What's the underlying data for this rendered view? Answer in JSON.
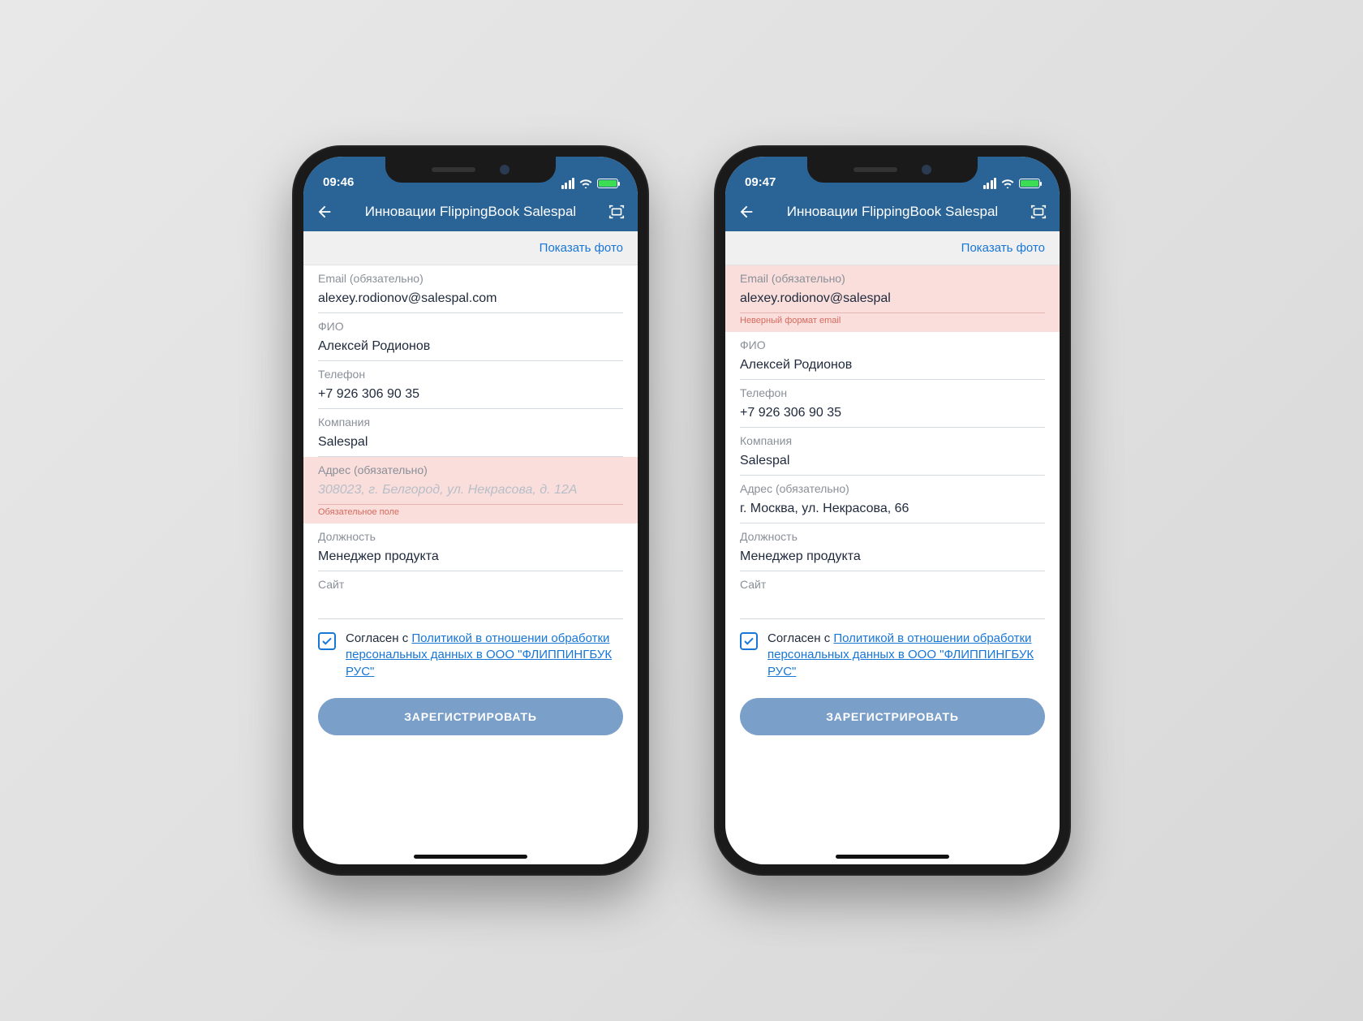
{
  "colors": {
    "headerBlue": "#2a6496",
    "linkBlue": "#1776d6",
    "errorBg": "#f9dedc",
    "errorText": "#d66a5e"
  },
  "phones": [
    {
      "status": {
        "time": "09:46"
      },
      "nav": {
        "title": "Инновации FlippingBook Salespal"
      },
      "subbar": {
        "showPhoto": "Показать фото"
      },
      "form": {
        "email": {
          "label": "Email (обязательно)",
          "value": "alexey.rodionov@salespal.com",
          "error": "",
          "hasError": false
        },
        "fio": {
          "label": "ФИО",
          "value": "Алексей Родионов"
        },
        "phone": {
          "label": "Телефон",
          "value": "+7 926 306 90 35"
        },
        "company": {
          "label": "Компания",
          "value": "Salespal"
        },
        "address": {
          "label": "Адрес (обязательно)",
          "value": "",
          "placeholder": "308023, г. Белгород, ул. Некрасова, д. 12А",
          "error": "Обязательное поле",
          "hasError": true
        },
        "position": {
          "label": "Должность",
          "value": "Менеджер продукта"
        },
        "site": {
          "label": "Сайт",
          "value": ""
        }
      },
      "consent": {
        "prefix": "Согласен с ",
        "link": "Политикой в отношении обработки персональных данных в ООО \"ФЛИППИНГБУК РУС\"",
        "checked": true
      },
      "submit": {
        "label": "ЗАРЕГИСТРИРОВАТЬ"
      }
    },
    {
      "status": {
        "time": "09:47"
      },
      "nav": {
        "title": "Инновации FlippingBook Salespal"
      },
      "subbar": {
        "showPhoto": "Показать фото"
      },
      "form": {
        "email": {
          "label": "Email (обязательно)",
          "value": "alexey.rodionov@salespal",
          "error": "Неверный формат email",
          "hasError": true
        },
        "fio": {
          "label": "ФИО",
          "value": "Алексей Родионов"
        },
        "phone": {
          "label": "Телефон",
          "value": "+7 926 306 90 35"
        },
        "company": {
          "label": "Компания",
          "value": "Salespal"
        },
        "address": {
          "label": "Адрес (обязательно)",
          "value": "г. Москва, ул. Некрасова, 66",
          "error": "",
          "hasError": false
        },
        "position": {
          "label": "Должность",
          "value": "Менеджер продукта"
        },
        "site": {
          "label": "Сайт",
          "value": ""
        }
      },
      "consent": {
        "prefix": "Согласен с ",
        "link": "Политикой в отношении обработки персональных данных в ООО \"ФЛИППИНГБУК РУС\"",
        "checked": true
      },
      "submit": {
        "label": "ЗАРЕГИСТРИРОВАТЬ"
      }
    }
  ]
}
